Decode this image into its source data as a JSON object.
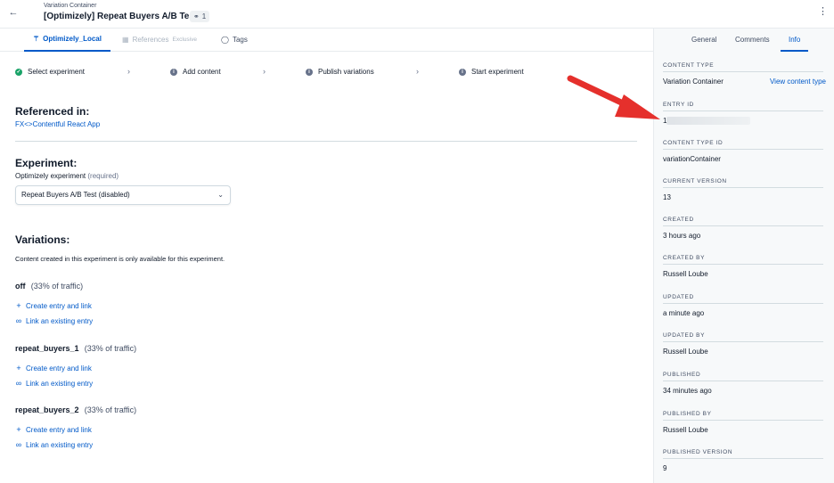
{
  "header": {
    "subtitle": "Variation Container",
    "title": "[Optimizely] Repeat Buyers A/B Test",
    "ref_count": "1",
    "more": "⋮"
  },
  "tabs": {
    "optimizely": "Optimizely_Local",
    "references": "References",
    "references_badge": "Exclusive",
    "tags": "Tags"
  },
  "steps": [
    {
      "label": "Select experiment",
      "status": "done"
    },
    {
      "label": "Add content",
      "status": "info"
    },
    {
      "label": "Publish variations",
      "status": "info"
    },
    {
      "label": "Start experiment",
      "status": "info"
    }
  ],
  "referenced": {
    "title": "Referenced in:",
    "link": "FX<>Contentful React App"
  },
  "experiment": {
    "title": "Experiment:",
    "field_label": "Optimizely experiment",
    "required": "(required)",
    "selected": "Repeat Buyers A/B Test (disabled)"
  },
  "variations": {
    "title": "Variations:",
    "note": "Content created in this experiment is only available for this experiment.",
    "create_label": "Create entry and link",
    "link_label": "Link an existing entry",
    "items": [
      {
        "name": "off",
        "traffic": "(33% of traffic)"
      },
      {
        "name": "repeat_buyers_1",
        "traffic": "(33% of traffic)"
      },
      {
        "name": "repeat_buyers_2",
        "traffic": "(33% of traffic)"
      }
    ]
  },
  "sidebar": {
    "tabs": [
      "General",
      "Comments",
      "Info"
    ],
    "active_tab": "Info",
    "view_content_type": "View content type",
    "fields": [
      {
        "label": "CONTENT TYPE",
        "value": "Variation Container"
      },
      {
        "label": "ENTRY ID",
        "value": "1"
      },
      {
        "label": "CONTENT TYPE ID",
        "value": "variationContainer"
      },
      {
        "label": "CURRENT VERSION",
        "value": "13"
      },
      {
        "label": "CREATED",
        "value": "3 hours ago"
      },
      {
        "label": "CREATED BY",
        "value": "Russell Loube"
      },
      {
        "label": "UPDATED",
        "value": "a minute ago"
      },
      {
        "label": "UPDATED BY",
        "value": "Russell Loube"
      },
      {
        "label": "PUBLISHED",
        "value": "34 minutes ago"
      },
      {
        "label": "PUBLISHED BY",
        "value": "Russell Loube"
      },
      {
        "label": "PUBLISHED VERSION",
        "value": "9"
      }
    ]
  },
  "colors": {
    "accent": "#0059c8",
    "success": "#1aa368",
    "annotation_arrow": "#e5302c"
  }
}
